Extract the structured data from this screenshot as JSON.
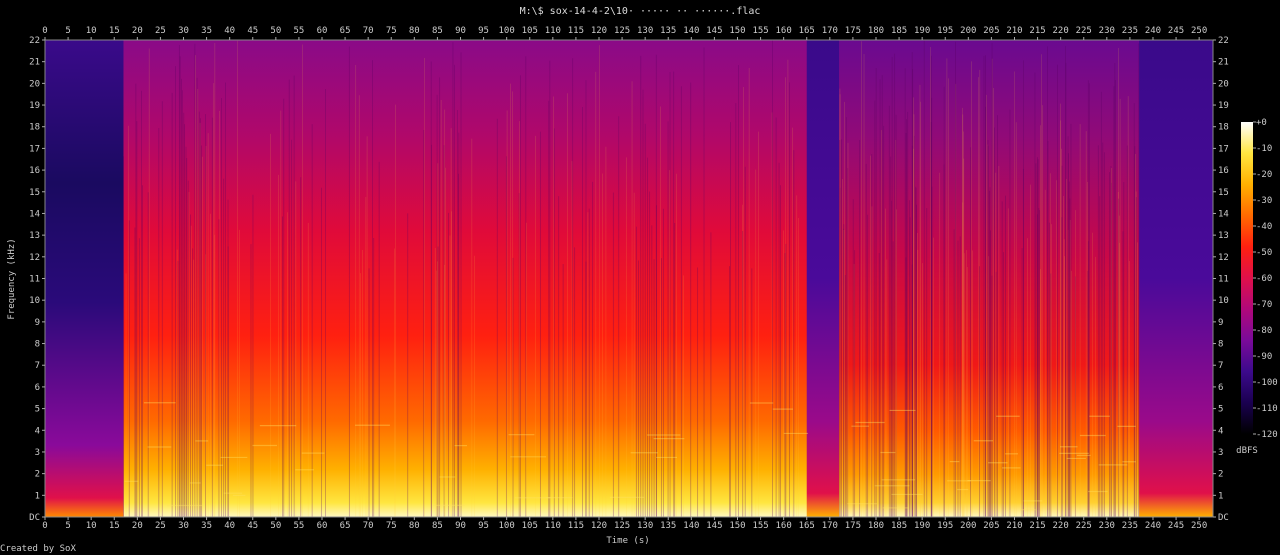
{
  "title": "M:\\$ sox-14-4-2\\10· ····· ·· ······.flac",
  "credit": "Created by SoX",
  "chart_data": {
    "type": "heatmap",
    "xlabel": "Time (s)",
    "ylabel": "Frequency (kHz)",
    "colorbar_label": "dBFS",
    "xlim": [
      0,
      253
    ],
    "ylim": [
      0,
      22
    ],
    "x_ticks": [
      "0",
      "5",
      "10",
      "15",
      "20",
      "25",
      "30",
      "35",
      "40",
      "45",
      "50",
      "55",
      "60",
      "65",
      "70",
      "75",
      "80",
      "85",
      "90",
      "95",
      "100",
      "105",
      "110",
      "115",
      "120",
      "125",
      "130",
      "135",
      "140",
      "145",
      "150",
      "155",
      "160",
      "165",
      "170",
      "175",
      "180",
      "185",
      "190",
      "195",
      "200",
      "205",
      "210",
      "215",
      "220",
      "225",
      "230",
      "235",
      "240",
      "245",
      "250"
    ],
    "y_ticks": [
      "DC",
      "1",
      "2",
      "3",
      "4",
      "5",
      "6",
      "7",
      "8",
      "9",
      "10",
      "11",
      "12",
      "13",
      "14",
      "15",
      "16",
      "17",
      "18",
      "19",
      "20",
      "21",
      "22"
    ],
    "colorbar_ticks": [
      "+0",
      "-10",
      "-20",
      "-30",
      "-40",
      "-50",
      "-60",
      "-70",
      "-80",
      "-90",
      "-100",
      "-110",
      "-120"
    ],
    "colorbar_range": [
      -120,
      0
    ],
    "colormap": [
      "#000000",
      "#1a0050",
      "#3c0a8c",
      "#7a0a9a",
      "#b0087a",
      "#e0104a",
      "#ff2010",
      "#ff6a00",
      "#ffb000",
      "#ffe640",
      "#ffffff"
    ],
    "segments": [
      {
        "start": 0,
        "end": 17,
        "level": "quiet intro"
      },
      {
        "start": 17,
        "end": 165,
        "level": "loud"
      },
      {
        "start": 165,
        "end": 172,
        "level": "quiet break"
      },
      {
        "start": 172,
        "end": 237,
        "level": "loud"
      },
      {
        "start": 237,
        "end": 253,
        "level": "quiet outro"
      }
    ]
  }
}
